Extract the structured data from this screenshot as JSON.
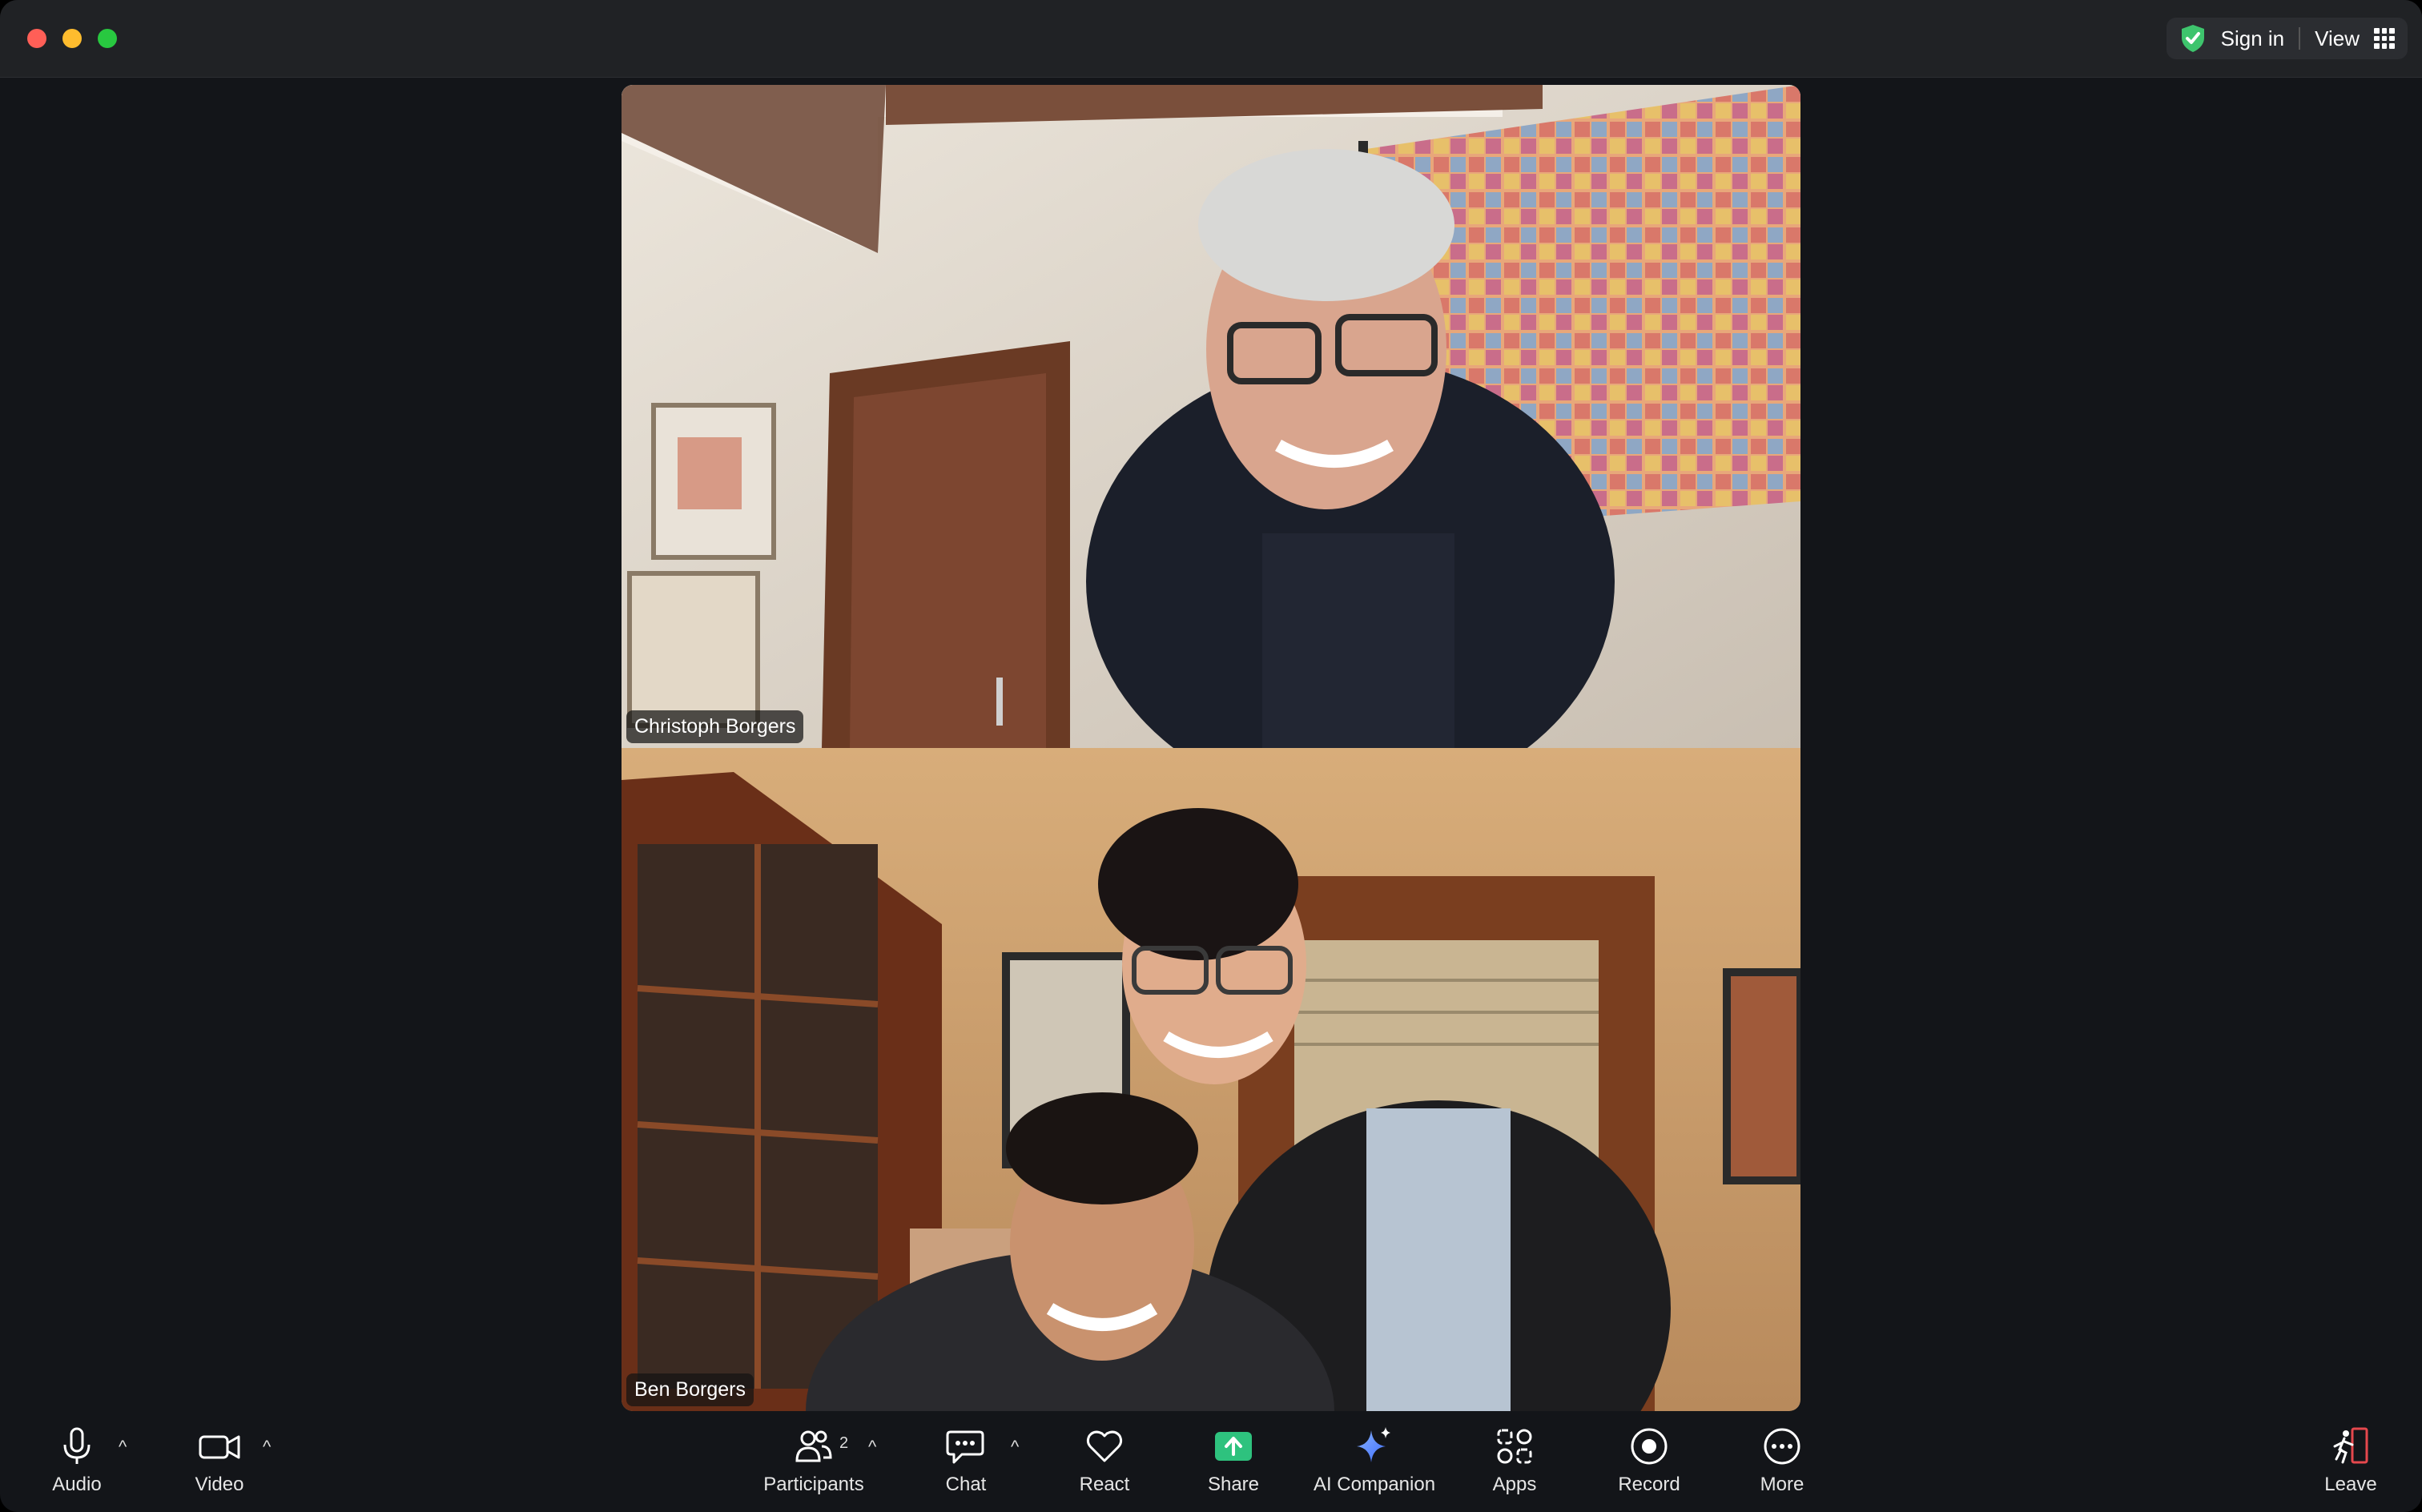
{
  "topbar": {
    "sign_in": "Sign in",
    "view": "View"
  },
  "participants": [
    {
      "name": "Christoph Borgers"
    },
    {
      "name": "Ben Borgers"
    }
  ],
  "toolbar": {
    "audio": "Audio",
    "video": "Video",
    "participants": "Participants",
    "participant_count": "2",
    "chat": "Chat",
    "react": "React",
    "share": "Share",
    "ai_companion": "AI Companion",
    "apps": "Apps",
    "record": "Record",
    "more": "More",
    "leave": "Leave"
  },
  "colors": {
    "window_bg": "#131519",
    "titlebar_bg": "#202225",
    "share_green": "#2ec27e",
    "shield_green": "#3ec46d",
    "leave_red": "#e5484d"
  }
}
